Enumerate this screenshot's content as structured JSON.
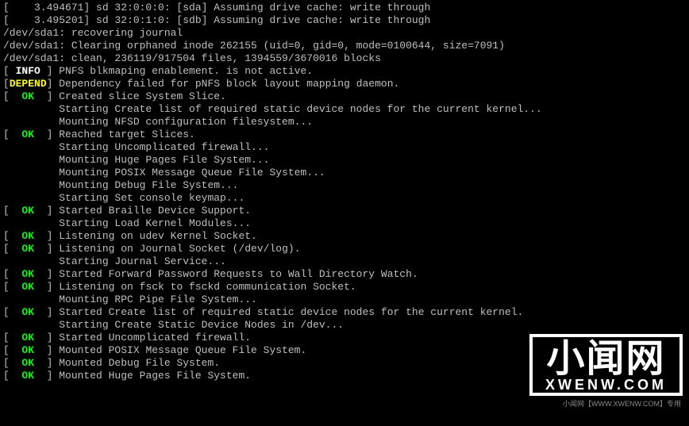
{
  "lines": [
    {
      "segments": [
        {
          "cls": "white",
          "text": "[    3.494671] sd 32:0:0:0: [sda] Assuming drive cache: write through"
        }
      ]
    },
    {
      "segments": [
        {
          "cls": "white",
          "text": "[    3.495201] sd 32:0:1:0: [sdb] Assuming drive cache: write through"
        }
      ]
    },
    {
      "segments": [
        {
          "cls": "white",
          "text": "/dev/sda1: recovering journal"
        }
      ]
    },
    {
      "segments": [
        {
          "cls": "white",
          "text": "/dev/sda1: Clearing orphaned inode 262155 (uid=0, gid=0, mode=0100644, size=7091)"
        }
      ]
    },
    {
      "segments": [
        {
          "cls": "white",
          "text": "/dev/sda1: clean, 236119/917504 files, 1394559/3670016 blocks"
        }
      ]
    },
    {
      "segments": [
        {
          "cls": "white",
          "text": "[ "
        },
        {
          "cls": "bold",
          "text": "INFO"
        },
        {
          "cls": "white",
          "text": " ] PNFS blkmaping enablement. is not active."
        }
      ]
    },
    {
      "segments": [
        {
          "cls": "white",
          "text": "["
        },
        {
          "cls": "yellow",
          "text": "DEPEND"
        },
        {
          "cls": "white",
          "text": "] Dependency failed for pNFS block layout mapping daemon."
        }
      ]
    },
    {
      "segments": [
        {
          "cls": "white",
          "text": "[  "
        },
        {
          "cls": "green",
          "text": "OK"
        },
        {
          "cls": "white",
          "text": "  ] Created slice System Slice."
        }
      ]
    },
    {
      "segments": [
        {
          "cls": "white",
          "text": "         Starting Create list of required static device nodes for the current kernel..."
        }
      ]
    },
    {
      "segments": [
        {
          "cls": "white",
          "text": "         Mounting NFSD configuration filesystem..."
        }
      ]
    },
    {
      "segments": [
        {
          "cls": "white",
          "text": "[  "
        },
        {
          "cls": "green",
          "text": "OK"
        },
        {
          "cls": "white",
          "text": "  ] Reached target Slices."
        }
      ]
    },
    {
      "segments": [
        {
          "cls": "white",
          "text": "         Starting Uncomplicated firewall..."
        }
      ]
    },
    {
      "segments": [
        {
          "cls": "white",
          "text": "         Mounting Huge Pages File System..."
        }
      ]
    },
    {
      "segments": [
        {
          "cls": "white",
          "text": "         Mounting POSIX Message Queue File System..."
        }
      ]
    },
    {
      "segments": [
        {
          "cls": "white",
          "text": "         Mounting Debug File System..."
        }
      ]
    },
    {
      "segments": [
        {
          "cls": "white",
          "text": "         Starting Set console keymap..."
        }
      ]
    },
    {
      "segments": [
        {
          "cls": "white",
          "text": "[  "
        },
        {
          "cls": "green",
          "text": "OK"
        },
        {
          "cls": "white",
          "text": "  ] Started Braille Device Support."
        }
      ]
    },
    {
      "segments": [
        {
          "cls": "white",
          "text": "         Starting Load Kernel Modules..."
        }
      ]
    },
    {
      "segments": [
        {
          "cls": "white",
          "text": "[  "
        },
        {
          "cls": "green",
          "text": "OK"
        },
        {
          "cls": "white",
          "text": "  ] Listening on udev Kernel Socket."
        }
      ]
    },
    {
      "segments": [
        {
          "cls": "white",
          "text": "[  "
        },
        {
          "cls": "green",
          "text": "OK"
        },
        {
          "cls": "white",
          "text": "  ] Listening on Journal Socket (/dev/log)."
        }
      ]
    },
    {
      "segments": [
        {
          "cls": "white",
          "text": "         Starting Journal Service..."
        }
      ]
    },
    {
      "segments": [
        {
          "cls": "white",
          "text": "[  "
        },
        {
          "cls": "green",
          "text": "OK"
        },
        {
          "cls": "white",
          "text": "  ] Started Forward Password Requests to Wall Directory Watch."
        }
      ]
    },
    {
      "segments": [
        {
          "cls": "white",
          "text": "[  "
        },
        {
          "cls": "green",
          "text": "OK"
        },
        {
          "cls": "white",
          "text": "  ] Listening on fsck to fsckd communication Socket."
        }
      ]
    },
    {
      "segments": [
        {
          "cls": "white",
          "text": "         Mounting RPC Pipe File System..."
        }
      ]
    },
    {
      "segments": [
        {
          "cls": "white",
          "text": "[  "
        },
        {
          "cls": "green",
          "text": "OK"
        },
        {
          "cls": "white",
          "text": "  ] Started Create list of required static device nodes for the current kernel."
        }
      ]
    },
    {
      "segments": [
        {
          "cls": "white",
          "text": "         Starting Create Static Device Nodes in /dev..."
        }
      ]
    },
    {
      "segments": [
        {
          "cls": "white",
          "text": "[  "
        },
        {
          "cls": "green",
          "text": "OK"
        },
        {
          "cls": "white",
          "text": "  ] Started Uncomplicated firewall."
        }
      ]
    },
    {
      "segments": [
        {
          "cls": "white",
          "text": "[  "
        },
        {
          "cls": "green",
          "text": "OK"
        },
        {
          "cls": "white",
          "text": "  ] Mounted POSIX Message Queue File System."
        }
      ]
    },
    {
      "segments": [
        {
          "cls": "white",
          "text": "[  "
        },
        {
          "cls": "green",
          "text": "OK"
        },
        {
          "cls": "white",
          "text": "  ] Mounted Debug File System."
        }
      ]
    },
    {
      "segments": [
        {
          "cls": "white",
          "text": "[  "
        },
        {
          "cls": "green",
          "text": "OK"
        },
        {
          "cls": "white",
          "text": "  ] Mounted Huge Pages File System."
        }
      ]
    }
  ],
  "watermark": {
    "chinese": "小闻网",
    "latin": "XWENW.COM",
    "footer": "小闻网【WWW.XWENW.COM】专用"
  }
}
